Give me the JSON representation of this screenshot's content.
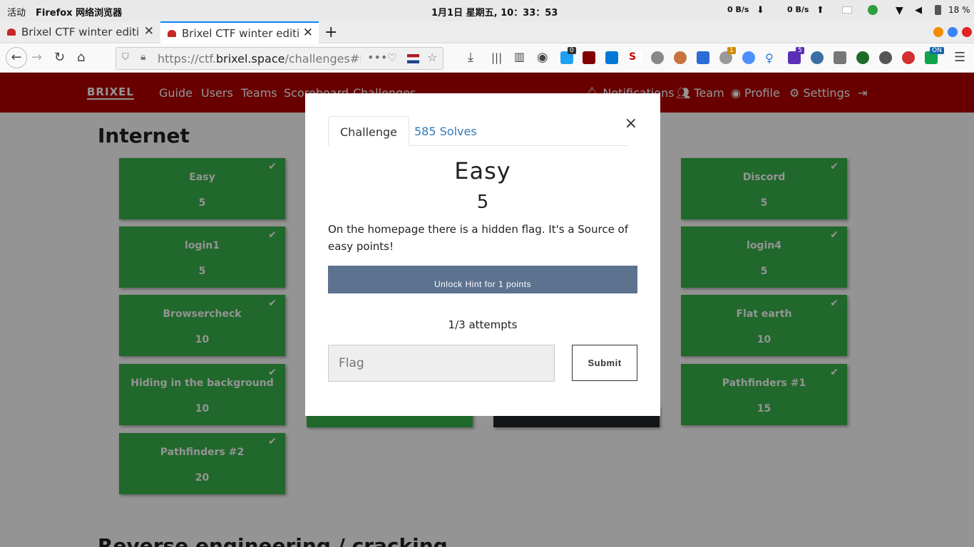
{
  "gnome": {
    "activities": "活动",
    "app_name": "Firefox 网络浏览器",
    "clock": "1月1日 星期五, 10：33：53",
    "net_down": "0 B/s",
    "net_up": "0 B/s",
    "battery": "18 %"
  },
  "tabs": [
    {
      "title": "Brixel CTF winter edition",
      "active": false
    },
    {
      "title": "Brixel CTF winter edition",
      "active": true
    }
  ],
  "url": {
    "prefix": "https://ctf.",
    "domain": "brixel.space",
    "path": "/challenges#Easy"
  },
  "extension_badges": {
    "counter_a": "0",
    "counter_b": "1",
    "counter_c": "5",
    "toggle": "ON"
  },
  "site": {
    "logo": "BRIXEL",
    "nav_left": [
      "Guide",
      "Users",
      "Teams",
      "Scoreboard",
      "Challenges"
    ],
    "nav_right": [
      "Notifications",
      "Team",
      "Profile",
      "Settings"
    ]
  },
  "category": "Internet",
  "next_category": "Reverse engineering / cracking",
  "cards": [
    {
      "name": "Easy",
      "value": "5"
    },
    {
      "name": "Discord",
      "value": "5"
    },
    {
      "name": "login1",
      "value": "5"
    },
    {
      "name": "login4",
      "value": "5"
    },
    {
      "name": "Browsercheck",
      "value": "10"
    },
    {
      "name": "Flat earth",
      "value": "10"
    },
    {
      "name": "Hiding in the background",
      "value": "10"
    },
    {
      "name": "Pathfinders #1",
      "value": "15"
    },
    {
      "name": "Pathfinders #2",
      "value": "20"
    }
  ],
  "modal": {
    "tab_challenge": "Challenge",
    "tab_solves": "585 Solves",
    "close": "×",
    "name": "Easy",
    "value": "5",
    "description": "On the homepage there is a hidden flag. It's a Source of easy points!",
    "hint_button": "Unlock Hint for 1 points",
    "attempts": "1/3 attempts",
    "flag_placeholder": "Flag",
    "submit": "Submit"
  }
}
